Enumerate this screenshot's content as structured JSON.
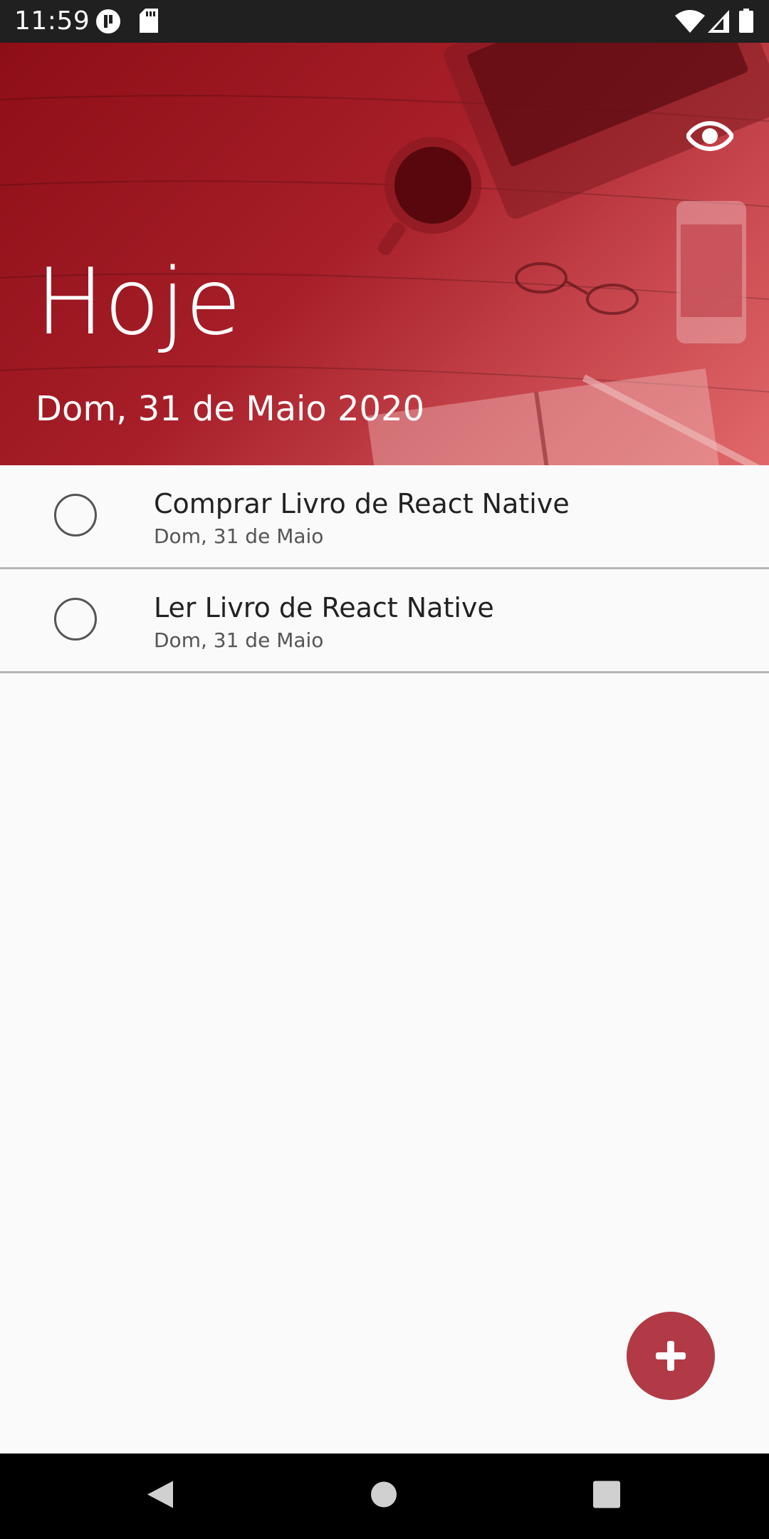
{
  "status_bar": {
    "time": "11:59",
    "icons": [
      "app-notification-icon",
      "sd-card-icon",
      "wifi-icon",
      "signal-icon",
      "battery-icon"
    ]
  },
  "header": {
    "title": "Hoje",
    "date": "Dom, 31 de Maio 2020",
    "toggle_icon": "eye-icon",
    "accent_color": "#a61e28"
  },
  "tasks": [
    {
      "title": "Comprar Livro de React Native",
      "date": "Dom, 31 de Maio",
      "done": false
    },
    {
      "title": "Ler Livro de React Native",
      "date": "Dom, 31 de Maio",
      "done": false
    }
  ],
  "fab": {
    "icon": "plus-icon",
    "color": "#b13a46"
  },
  "nav_bar": {
    "buttons": [
      "back-icon",
      "home-icon",
      "recents-icon"
    ]
  }
}
